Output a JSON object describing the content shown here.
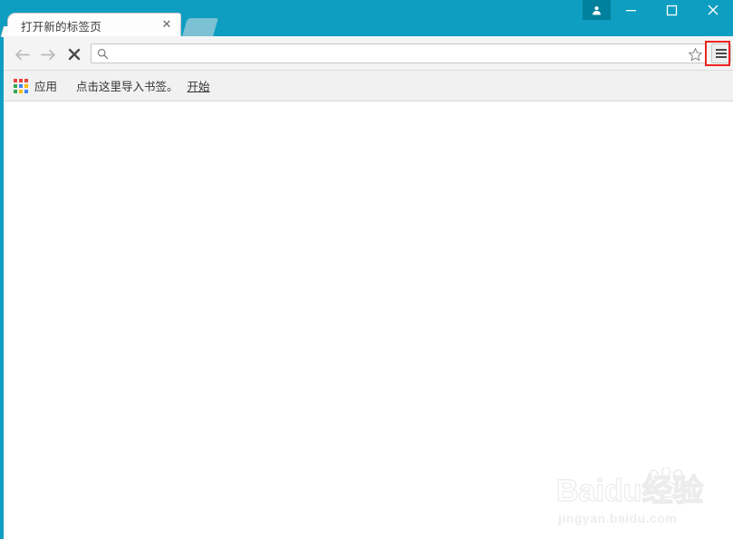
{
  "window": {
    "titlebar_color": "#0d9ec1",
    "avatar_button_color": "#00809c",
    "controls": {
      "avatar_label": "person-icon",
      "minimize_label": "—",
      "maximize_label": "□",
      "close_label": "✕"
    }
  },
  "tabs": [
    {
      "title": "打开新的标签页",
      "close_label": "✕",
      "active": true
    }
  ],
  "new_tab_button": {
    "label": "",
    "icon": "new-tab-icon"
  },
  "toolbar": {
    "back_icon": "arrow-left-icon",
    "forward_icon": "arrow-right-icon",
    "stop_icon": "close-x-icon",
    "search_icon": "search-icon",
    "star_icon": "star-icon",
    "menu_icon": "hamburger-menu-icon",
    "omnibox": {
      "value": "",
      "placeholder": ""
    },
    "highlight_color": "#ee2222"
  },
  "bookmarks_bar": {
    "apps": {
      "icon": "apps-grid-icon",
      "label": "应用"
    },
    "import_text": "点击这里导入书签。",
    "start_link": "开始"
  },
  "page": {
    "body_text": ""
  },
  "watermark": {
    "main_text": "Baidu经验",
    "sub_text": "jingyan.baidu.com"
  }
}
